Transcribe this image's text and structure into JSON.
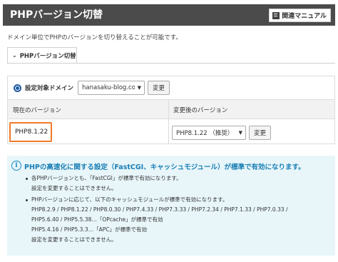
{
  "header": {
    "title": "PHPバージョン切替",
    "manual_label": "関連マニュアル"
  },
  "description": "ドメイン単位でPHPのバージョンを切り替えることが可能です。",
  "tab": {
    "label": "PHPバージョン切替"
  },
  "domain": {
    "label": "設定対象ドメイン",
    "selected": "hanasaku-blog.com",
    "change_label": "変更"
  },
  "version_table": {
    "current_header": "現在のバージョン",
    "new_header": "変更後のバージョン",
    "current_version": "PHP8.1.22",
    "selected_version": "PHP8.1.22 （推奨）",
    "change_label": "変更"
  },
  "info": {
    "title": "PHPの高速化に関する設定（FastCGI、キャッシュモジュール）が標準で有効になります。",
    "lines": [
      "各PHPバージョンとも、「FastCGI」が標準で有効になります。",
      "設定を変更することはできません。",
      "PHPバージョンに応じて、以下のキャッシュモジュールが標準で有効になります。",
      "PHP8.2.9 / PHP8.1.22 / PHP8.0.30 / PHP7.4.33 / PHP7.3.33 / PHP7.2.34 / PHP7.1.33 / PHP7.0.33 /",
      "PHP5.6.40 / PHP5.5.38…「OPcache」が標準で有効",
      "PHP5.4.16 / PHP5.3.3…「APC」が標準で有効",
      "設定を変更することはできません。"
    ]
  },
  "colors": {
    "header_bg": "#4b4b4b",
    "highlight_border": "#f07a28",
    "info_bg": "#e8f6fa",
    "info_title": "#1a7fb5",
    "radio": "#1e5aa0"
  },
  "icons": {
    "manual": "book-icon",
    "tab": "chevron-down-icon",
    "info": "info-icon"
  }
}
